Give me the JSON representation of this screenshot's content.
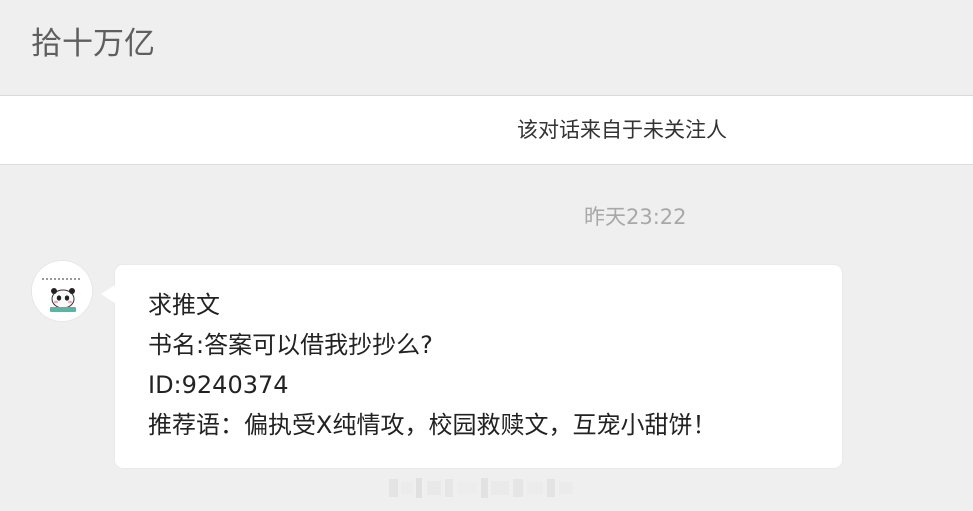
{
  "header": {
    "title": "拾十万亿"
  },
  "notice": {
    "text": "该对话来自于未关注人"
  },
  "message": {
    "timestamp": "昨天23:22",
    "avatar_icon": "panda-sticker-avatar",
    "lines": [
      "求推文",
      "书名:答案可以借我抄抄么?",
      "ID:9240374",
      "推荐语：偏执受X纯情攻，校园救赎文，互宠小甜饼！"
    ]
  },
  "colors": {
    "background": "#efefef",
    "bubble": "#ffffff",
    "title_text": "#5f5f5f",
    "timestamp_text": "#a8a8a8",
    "message_text": "#222222"
  }
}
